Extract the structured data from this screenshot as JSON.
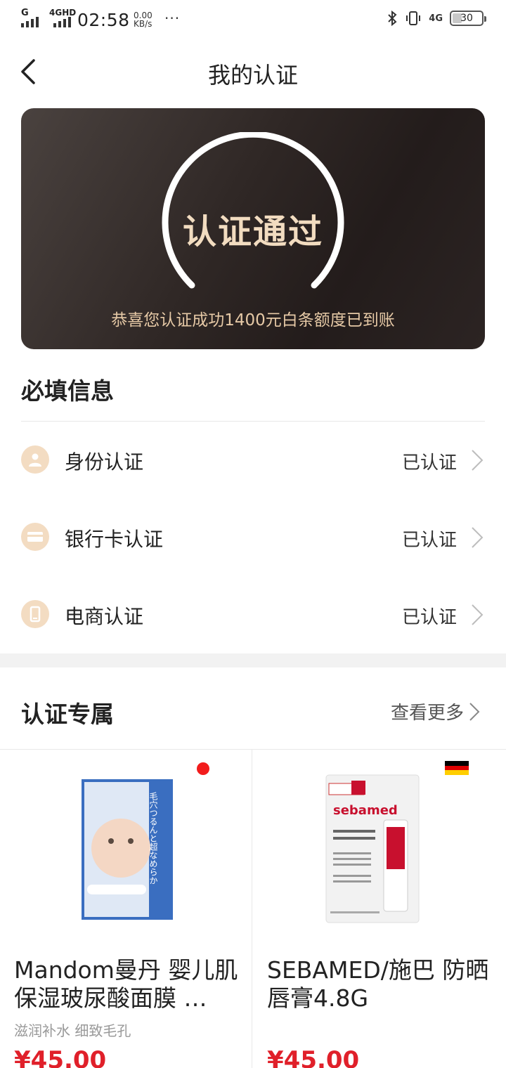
{
  "status_bar": {
    "signal1_label": "G",
    "signal2_label": "4GHD",
    "time": "02:58",
    "speed_value": "0.00",
    "speed_unit": "KB/s",
    "more": "···",
    "network_right": "4G",
    "battery": "30"
  },
  "header": {
    "title": "我的认证"
  },
  "card": {
    "status": "认证通过",
    "message": "恭喜您认证成功1400元白条额度已到账"
  },
  "required": {
    "title": "必填信息",
    "items": [
      {
        "label": "身份认证",
        "status": "已认证",
        "icon": "person-icon"
      },
      {
        "label": "银行卡认证",
        "status": "已认证",
        "icon": "card-icon"
      },
      {
        "label": "电商认证",
        "status": "已认证",
        "icon": "phone-icon"
      }
    ]
  },
  "exclusive": {
    "title": "认证专属",
    "see_more": "查看更多"
  },
  "products": [
    {
      "name": "Mandom曼丹 婴儿肌保湿玻尿酸面膜 …",
      "subtitle": "滋润补水 细致毛孔",
      "price": "¥45.00",
      "badge": "red-dot",
      "img_text": "毛穴つるんと超なめらか"
    },
    {
      "name": "SEBAMED/施巴 防晒唇膏4.8G",
      "subtitle": "",
      "price": "¥45.00",
      "badge": "germany-flag",
      "img_text": "sebamed"
    }
  ],
  "colors": {
    "card_text": "#f2dcc0",
    "price": "#e0202a",
    "icon_bg": "#f3dcc2"
  }
}
